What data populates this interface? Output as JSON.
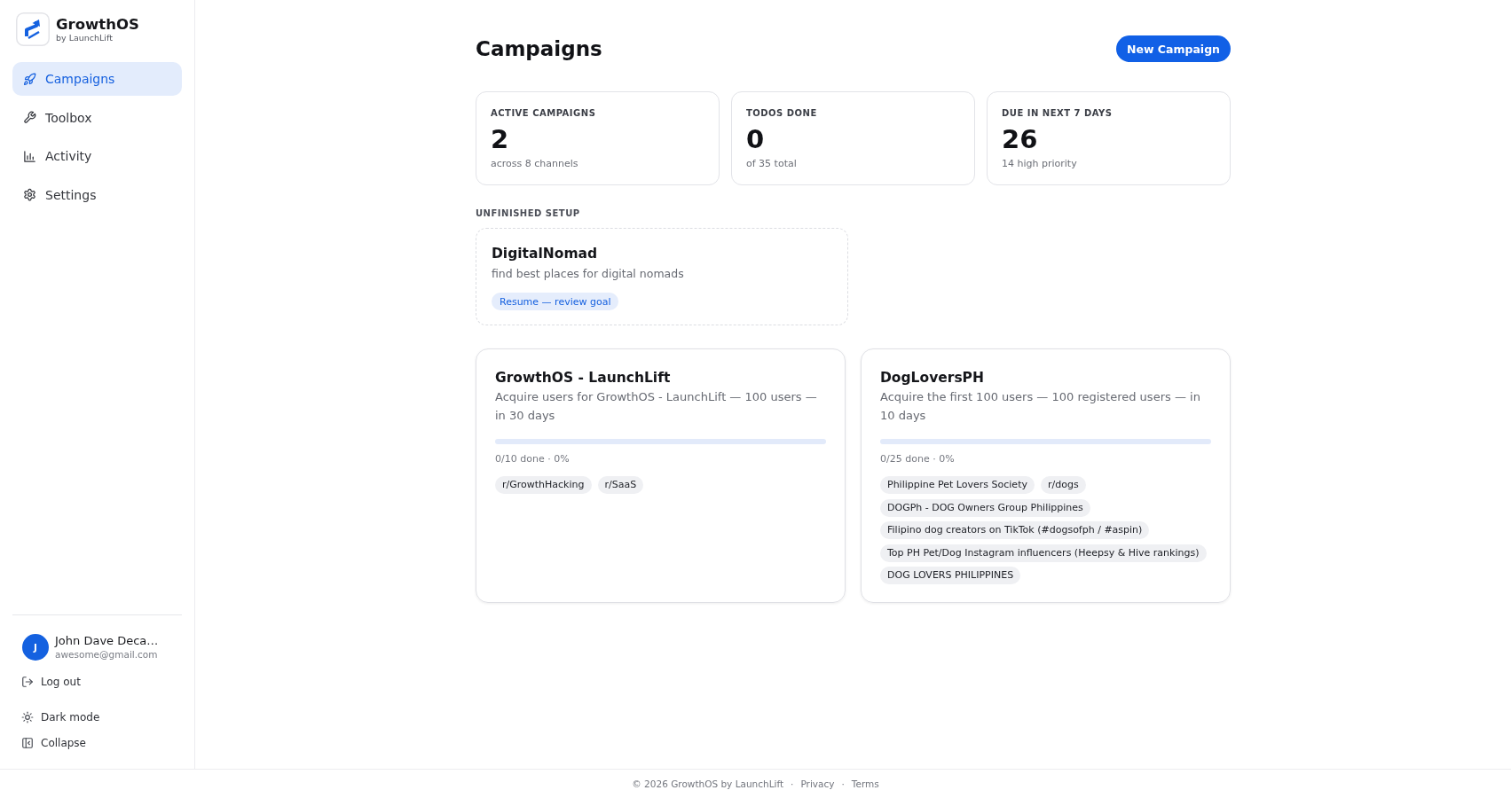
{
  "sidebar": {
    "brand": {
      "name": "GrowthOS",
      "tagline": "by LaunchLift"
    },
    "nav": [
      {
        "label": "Campaigns",
        "selected": true
      },
      {
        "label": "Toolbox",
        "selected": false
      },
      {
        "label": "Activity",
        "selected": false
      },
      {
        "label": "Settings",
        "selected": false
      }
    ],
    "user": {
      "initial": "J",
      "name": "John Dave Deca…",
      "email": "awesome@gmail.com"
    },
    "logout": "Log out",
    "utilities": [
      "Dark mode",
      "Collapse"
    ]
  },
  "header": {
    "title": "Campaigns",
    "primary_button": "New Campaign"
  },
  "stats": [
    {
      "label": "ACTIVE CAMPAIGNS",
      "value": "2",
      "note": "across 8 channels"
    },
    {
      "label": "TODOS DONE",
      "value": "0",
      "note": "of 35 total"
    },
    {
      "label": "DUE IN NEXT 7 DAYS",
      "value": "26",
      "note": "14 high priority"
    }
  ],
  "unfinished_setup": {
    "heading": "UNFINISHED SETUP",
    "items": [
      {
        "title": "DigitalNomad",
        "description": "find best places for digital nomads",
        "action": "Resume — review goal"
      }
    ]
  },
  "campaigns": [
    {
      "title": "GrowthOS - LaunchLift",
      "description": "Acquire users for GrowthOS - LaunchLift — 100 users — in 30 days",
      "progress_text": "0/10 done · 0%",
      "channels": [
        "r/GrowthHacking",
        "r/SaaS"
      ]
    },
    {
      "title": "DogLoversPH",
      "description": "Acquire the first 100 users — 100 registered users — in 10 days",
      "progress_text": "0/25 done · 0%",
      "channels": [
        "Philippine Pet Lovers Society",
        "r/dogs",
        "DOGPh - DOG Owners Group Philippines",
        "Filipino dog creators on TikTok (#dogsofph / #aspin)",
        "Top PH Pet/Dog Instagram influencers (Heepsy & Hive rankings)",
        "DOG LOVERS PHILIPPINES"
      ]
    }
  ],
  "footer": {
    "copyright": "© 2026 GrowthOS by LaunchLift",
    "separator": "·",
    "links": [
      "Privacy",
      "Terms"
    ]
  }
}
